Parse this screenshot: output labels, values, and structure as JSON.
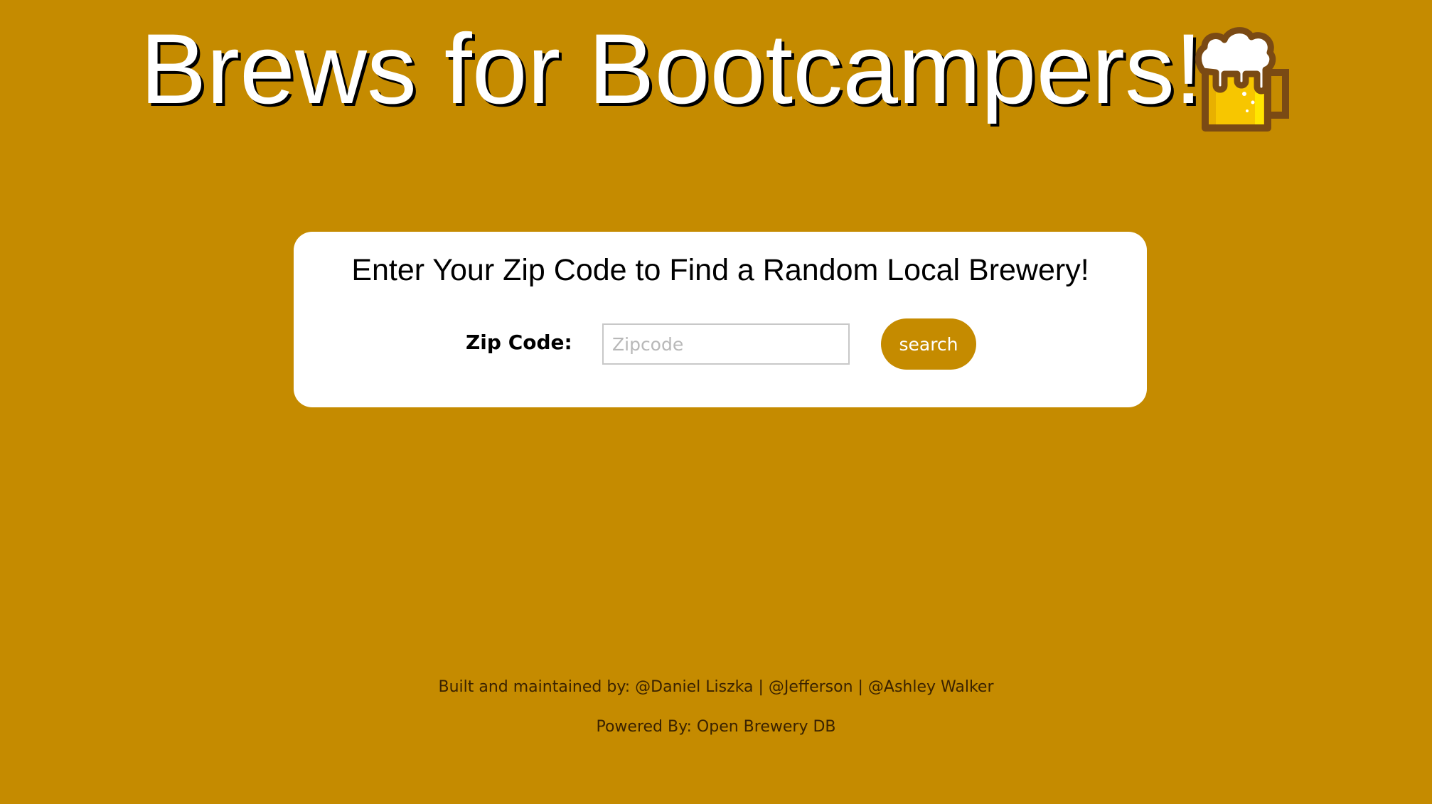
{
  "header": {
    "title": "Brews for Bootcampers!",
    "logo_icon": "beer-mug-icon"
  },
  "search_card": {
    "heading": "Enter Your Zip Code to Find a Random Local Brewery!",
    "zip_label": "Zip Code:",
    "zip_placeholder": "Zipcode",
    "zip_value": "",
    "search_label": "search"
  },
  "footer": {
    "credits": "Built and maintained by: @Daniel Liszka | @Jefferson | @Ashley Walker",
    "powered_by": "Powered By: Open Brewery DB"
  },
  "colors": {
    "background": "#C58B00",
    "card": "#FFFFFF",
    "button": "#C58B00",
    "title_text": "#FFFFFF",
    "mug_outline": "#7A4A14",
    "beer": "#F7C600"
  }
}
